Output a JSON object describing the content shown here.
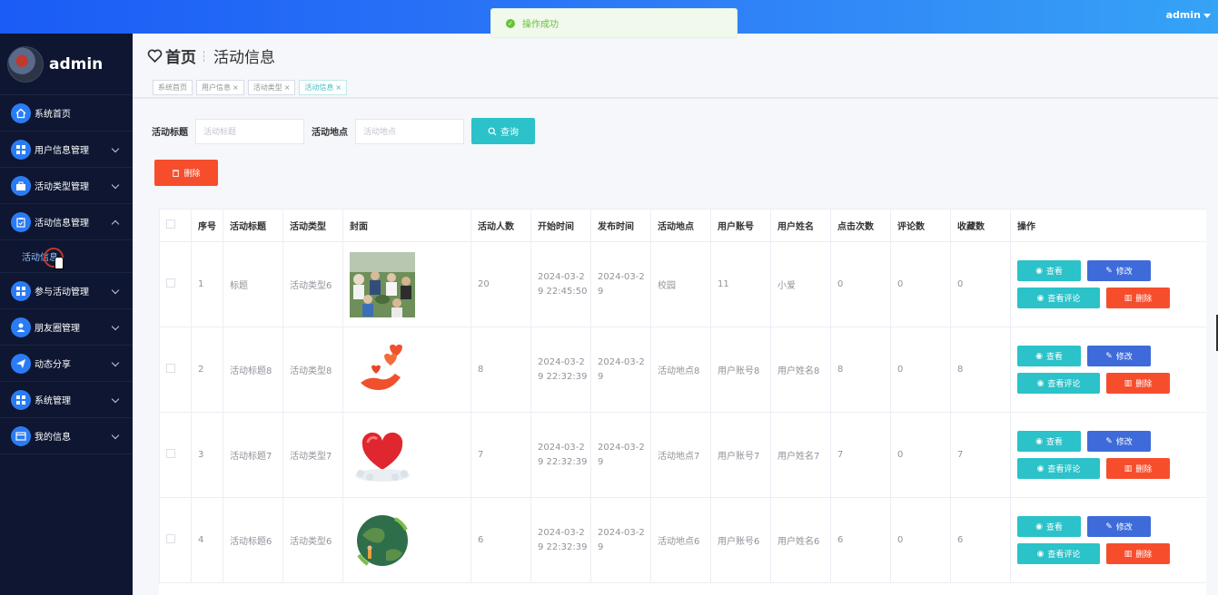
{
  "topbar": {
    "user": "admin",
    "toast": "操作成功"
  },
  "sidebar": {
    "username": "admin",
    "items": [
      {
        "label": "系统首页",
        "icon": "home-icon",
        "expandable": false
      },
      {
        "label": "用户信息管理",
        "icon": "grid-icon",
        "expandable": true
      },
      {
        "label": "活动类型管理",
        "icon": "briefcase-icon",
        "expandable": true
      },
      {
        "label": "活动信息管理",
        "icon": "clipboard-icon",
        "expandable": true,
        "open": true
      },
      {
        "label": "参与活动管理",
        "icon": "grid-icon",
        "expandable": true
      },
      {
        "label": "朋友圈管理",
        "icon": "user-icon",
        "expandable": true
      },
      {
        "label": "动态分享",
        "icon": "send-icon",
        "expandable": true
      },
      {
        "label": "系统管理",
        "icon": "grid-icon",
        "expandable": true
      },
      {
        "label": "我的信息",
        "icon": "window-icon",
        "expandable": true
      }
    ],
    "submenu": {
      "label": "活动信息"
    }
  },
  "header": {
    "home": "首页",
    "current": "活动信息",
    "tags": [
      {
        "label": "系统首页",
        "closable": false,
        "active": false
      },
      {
        "label": "用户信息",
        "closable": true,
        "active": false
      },
      {
        "label": "活动类型",
        "closable": true,
        "active": false
      },
      {
        "label": "活动信息",
        "closable": true,
        "active": true
      }
    ]
  },
  "search": {
    "title_label": "活动标题",
    "title_placeholder": "活动标题",
    "place_label": "活动地点",
    "place_placeholder": "活动地点",
    "query_button": "查询",
    "delete_button": "删除"
  },
  "table": {
    "columns": [
      "序号",
      "活动标题",
      "活动类型",
      "封面",
      "活动人数",
      "开始时间",
      "发布时间",
      "活动地点",
      "用户账号",
      "用户姓名",
      "点击次数",
      "评论数",
      "收藏数",
      "操作"
    ],
    "rows": [
      {
        "no": "1",
        "title": "标题",
        "type": "活动类型6",
        "people": "20",
        "start1": "2024-03-2",
        "start2": "9 22:45:50",
        "pub1": "2024-03-2",
        "pub2": "9",
        "place": "校园",
        "account": "11",
        "name": "小爱",
        "clicks": "0",
        "comments": "0",
        "favorites": "0",
        "cover": "photo"
      },
      {
        "no": "2",
        "title": "活动标题8",
        "type": "活动类型8",
        "people": "8",
        "start1": "2024-03-2",
        "start2": "9 22:32:39",
        "pub1": "2024-03-2",
        "pub2": "9",
        "place": "活动地点8",
        "account": "用户账号8",
        "name": "用户姓名8",
        "clicks": "8",
        "comments": "0",
        "favorites": "8",
        "cover": "hand-hearts"
      },
      {
        "no": "3",
        "title": "活动标题7",
        "type": "活动类型7",
        "people": "7",
        "start1": "2024-03-2",
        "start2": "9 22:32:39",
        "pub1": "2024-03-2",
        "pub2": "9",
        "place": "活动地点7",
        "account": "用户账号7",
        "name": "用户姓名7",
        "clicks": "7",
        "comments": "0",
        "favorites": "7",
        "cover": "heart-hands"
      },
      {
        "no": "4",
        "title": "活动标题6",
        "type": "活动类型6",
        "people": "6",
        "start1": "2024-03-2",
        "start2": "9 22:32:39",
        "pub1": "2024-03-2",
        "pub2": "9",
        "place": "活动地点6",
        "account": "用户账号6",
        "name": "用户姓名6",
        "clicks": "6",
        "comments": "0",
        "favorites": "6",
        "cover": "earth"
      }
    ],
    "actions": {
      "view": "查看",
      "edit": "修改",
      "comments": "查看评论",
      "delete": "删除"
    }
  },
  "colors": {
    "primary": "#2a7cf5",
    "teal": "#2bc2c9",
    "danger": "#f64e2d",
    "edit": "#3e6bd9",
    "sidebar": "#0e1631"
  }
}
